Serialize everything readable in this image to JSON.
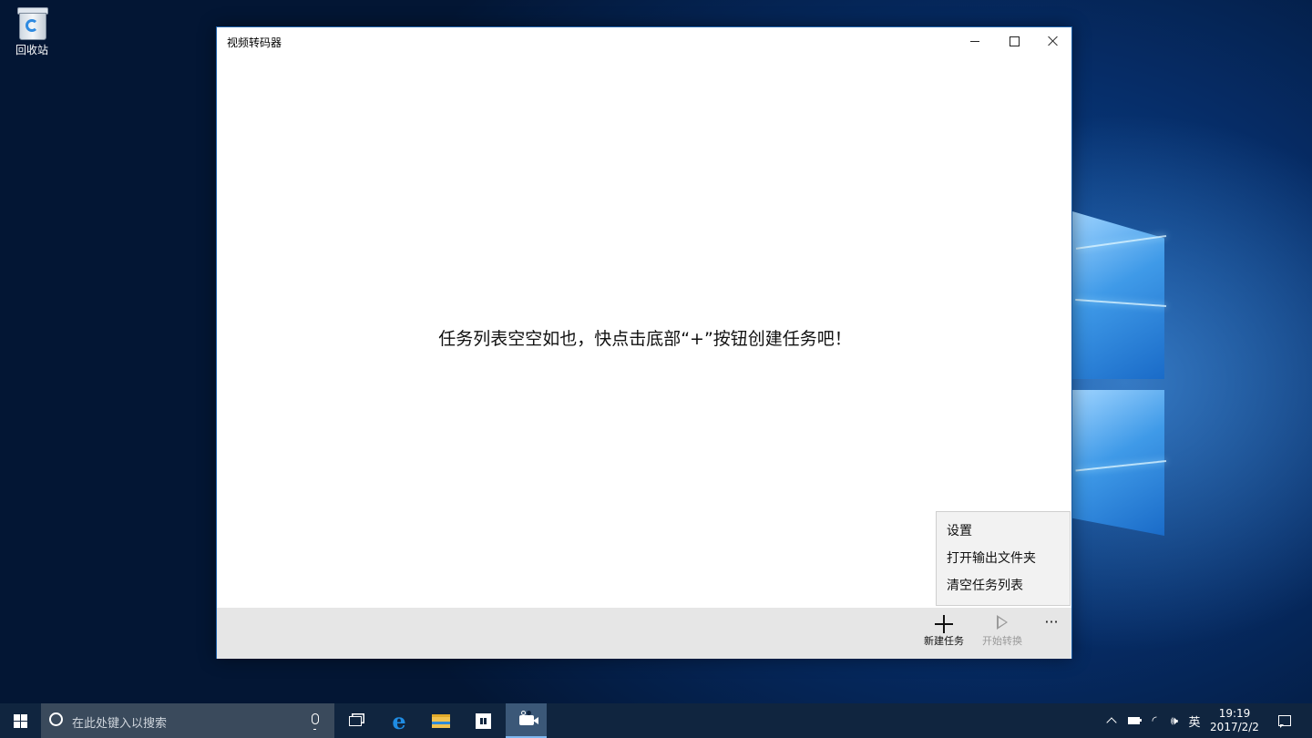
{
  "desktop": {
    "recycle_bin_label": "回收站"
  },
  "window": {
    "title": "视频转码器",
    "empty_message": "任务列表空空如也，快点击底部“+”按钮创建任务吧！",
    "command_bar": {
      "new_task_label": "新建任务",
      "start_label": "开始转换",
      "more_label": "···"
    },
    "overflow_menu": {
      "items": [
        {
          "label": "设置"
        },
        {
          "label": "打开输出文件夹"
        },
        {
          "label": "清空任务列表"
        }
      ]
    }
  },
  "taskbar": {
    "search_placeholder": "在此处键入以搜索",
    "ime_indicator": "英",
    "clock_time": "19:19",
    "clock_date": "2017/2/2"
  },
  "colors": {
    "accent": "#1c5fa8",
    "taskbar": "#10253f",
    "command_bar": "#e6e6e6"
  }
}
